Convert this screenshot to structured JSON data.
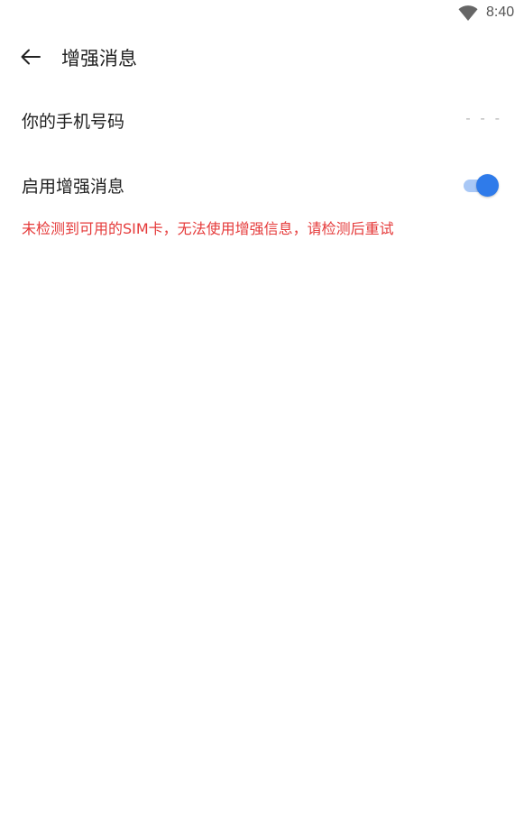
{
  "status_bar": {
    "time": "8:40",
    "wifi_icon": "wifi-icon"
  },
  "app_bar": {
    "back_icon": "arrow-left-icon",
    "title": "增强消息"
  },
  "settings": {
    "phone_number": {
      "label": "你的手机号码",
      "value": "- - -"
    },
    "enhanced_messaging": {
      "label": "启用增强消息",
      "toggle_on": true
    }
  },
  "error_message": "未检测到可用的SIM卡，无法使用增强信息，请检测后重试",
  "colors": {
    "accent": "#2f7bea",
    "accent_track": "#a9c8f6",
    "error": "#e53a3a",
    "muted": "#b5b5b5"
  }
}
